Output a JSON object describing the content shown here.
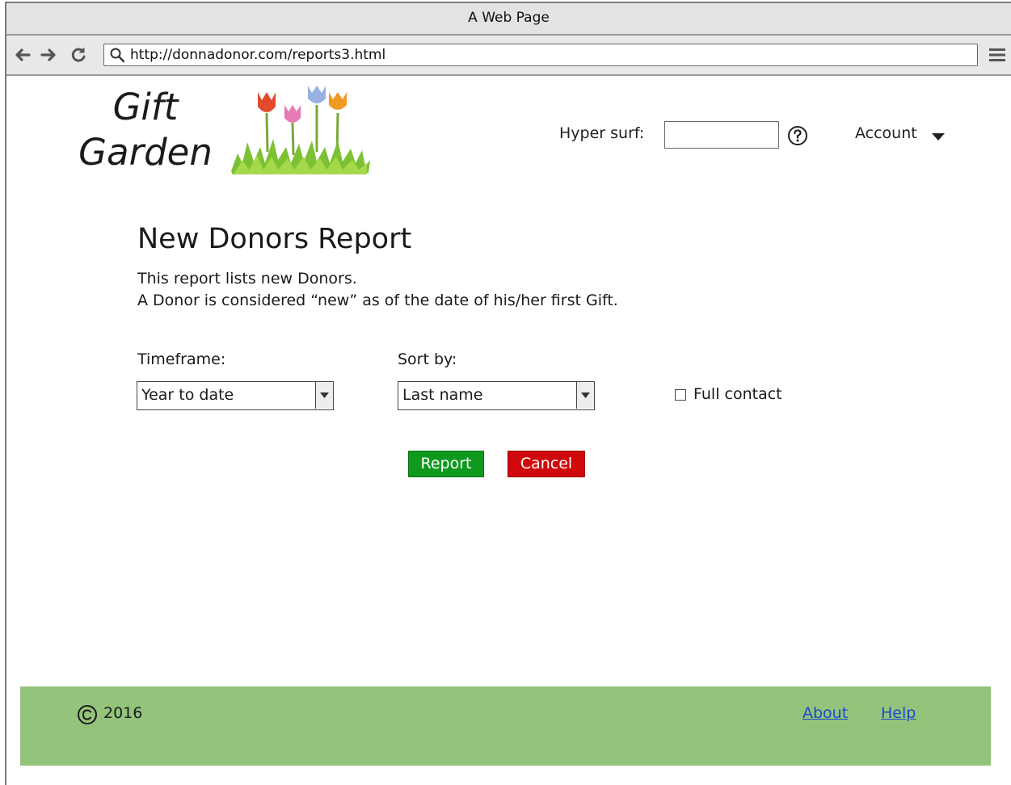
{
  "window": {
    "title": "A Web Page"
  },
  "browser": {
    "url": "http://donnadonor.com/reports3.html"
  },
  "logo": {
    "line1": "Gift",
    "line2": "Garden"
  },
  "header": {
    "search_label": "Hyper surf:",
    "search_value": "",
    "account_label": "Account"
  },
  "page": {
    "title": "New Donors Report",
    "description_line1": "This report lists new Donors.",
    "description_line2": "A Donor is considered “new” as of the date of his/her first Gift."
  },
  "form": {
    "timeframe_label": "Timeframe:",
    "timeframe_value": "Year to date",
    "sort_label": "Sort by:",
    "sort_value": "Last name",
    "full_contact_label": "Full contact",
    "full_contact_checked": false
  },
  "buttons": {
    "report": "Report",
    "cancel": "Cancel"
  },
  "footer": {
    "year": "2016",
    "links": [
      "About",
      "Help"
    ]
  },
  "colors": {
    "report_button": "#0f9a1e",
    "cancel_button": "#d0080c",
    "footer_bg": "#94c47c",
    "link": "#1a4cc7"
  }
}
